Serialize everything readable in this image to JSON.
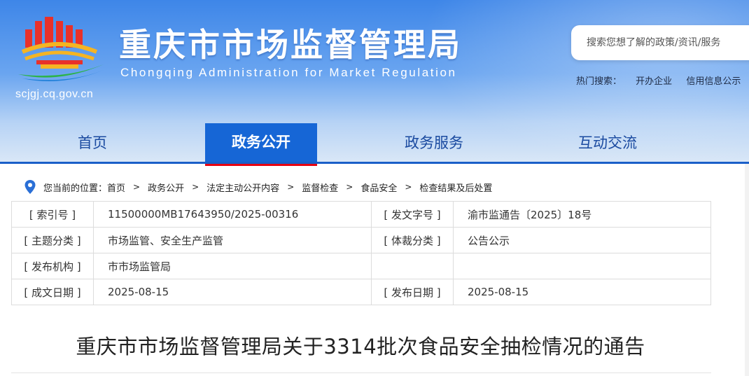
{
  "header": {
    "title_cn": "重庆市市场监督管理局",
    "title_en": "Chongqing  Administration for Market Regulation",
    "site_url": "scjgj.cq.gov.cn",
    "search": {
      "placeholder": "搜索您想了解的政策/资讯/服务"
    },
    "hot_search": {
      "label": "热门搜索：",
      "items": [
        "开办企业",
        "信用信息公示"
      ]
    }
  },
  "nav": {
    "items": [
      {
        "label": "首页"
      },
      {
        "label": "政务公开",
        "active": true
      },
      {
        "label": "政务服务"
      },
      {
        "label": "互动交流"
      }
    ]
  },
  "breadcrumb": {
    "prefix": "您当前的位置：",
    "items": [
      "首页",
      "政务公开",
      "法定主动公开内容",
      "监督检查",
      "食品安全",
      "检查结果及后处置"
    ],
    "separator": ">"
  },
  "meta": {
    "rows": [
      {
        "k1": "[ 索引号 ]",
        "v1": "11500000MB17643950/2025-00316",
        "k2": "[ 发文字号 ]",
        "v2": "渝市监通告〔2025〕18号"
      },
      {
        "k1": "[ 主题分类 ]",
        "v1": "市场监管、安全生产监管",
        "k2": "[ 体裁分类 ]",
        "v2": "公告公示"
      },
      {
        "k1": "[ 发布机构 ]",
        "v1": "市市场监管局",
        "k2": "",
        "v2": ""
      },
      {
        "k1": "[ 成文日期 ]",
        "v1": "2025-08-15",
        "k2": "[ 发布日期 ]",
        "v2": "2025-08-15"
      }
    ]
  },
  "article": {
    "title": "重庆市市场监督管理局关于3314批次食品安全抽检情况的通告"
  },
  "colors": {
    "nav_active_bg": "#1666d6",
    "nav_active_underline": "#e60012",
    "nav_text": "#1a4aa0"
  }
}
